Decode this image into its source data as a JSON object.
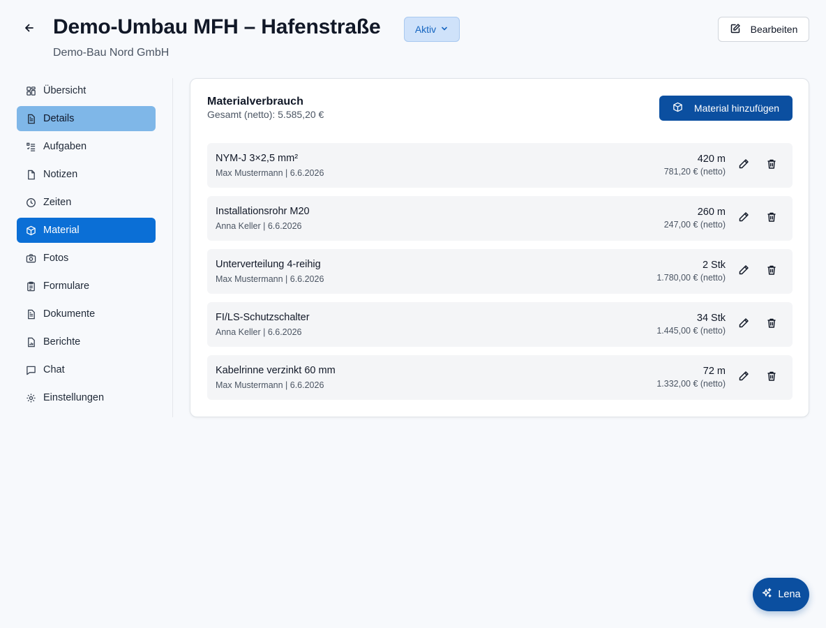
{
  "header": {
    "title": "Demo-Umbau MFH – Hafenstraße",
    "status": "Aktiv",
    "subtitle": "Demo-Bau Nord GmbH",
    "edit_label": "Bearbeiten"
  },
  "sidebar": {
    "items": [
      {
        "label": "Übersicht",
        "icon": "grid-icon"
      },
      {
        "label": "Details",
        "icon": "file-text-icon"
      },
      {
        "label": "Aufgaben",
        "icon": "list-check-icon"
      },
      {
        "label": "Notizen",
        "icon": "note-icon"
      },
      {
        "label": "Zeiten",
        "icon": "clock-icon"
      },
      {
        "label": "Material",
        "icon": "box-icon"
      },
      {
        "label": "Fotos",
        "icon": "camera-icon"
      },
      {
        "label": "Formulare",
        "icon": "clipboard-icon"
      },
      {
        "label": "Dokumente",
        "icon": "document-icon"
      },
      {
        "label": "Berichte",
        "icon": "report-icon"
      },
      {
        "label": "Chat",
        "icon": "chat-icon"
      },
      {
        "label": "Einstellungen",
        "icon": "gear-icon"
      }
    ],
    "hover_item": "Details",
    "active_item": "Material"
  },
  "material": {
    "title": "Materialverbrauch",
    "total": "Gesamt (netto): 5.585,20 €",
    "add_label": "Material hinzufügen",
    "items": [
      {
        "name": "NYM-J 3×2,5 mm²",
        "meta": "Max Mustermann | 6.6.2026",
        "qty": "420 m",
        "price": "781,20 € (netto)"
      },
      {
        "name": "Installationsrohr M20",
        "meta": "Anna Keller | 6.6.2026",
        "qty": "260 m",
        "price": "247,00 € (netto)"
      },
      {
        "name": "Unterverteilung 4-reihig",
        "meta": "Max Mustermann | 6.6.2026",
        "qty": "2 Stk",
        "price": "1.780,00 € (netto)"
      },
      {
        "name": "FI/LS-Schutzschalter",
        "meta": "Anna Keller | 6.6.2026",
        "qty": "34 Stk",
        "price": "1.445,00 € (netto)"
      },
      {
        "name": "Kabelrinne verzinkt 60 mm",
        "meta": "Max Mustermann | 6.6.2026",
        "qty": "72 m",
        "price": "1.332,00 € (netto)"
      }
    ]
  },
  "assistant": {
    "label": "Lena"
  },
  "colors": {
    "accent": "#0b6fd6",
    "primary_button": "#0b4fa0",
    "hover_nav": "#7fb7e8",
    "status_pill_bg": "#cfe2fa"
  }
}
